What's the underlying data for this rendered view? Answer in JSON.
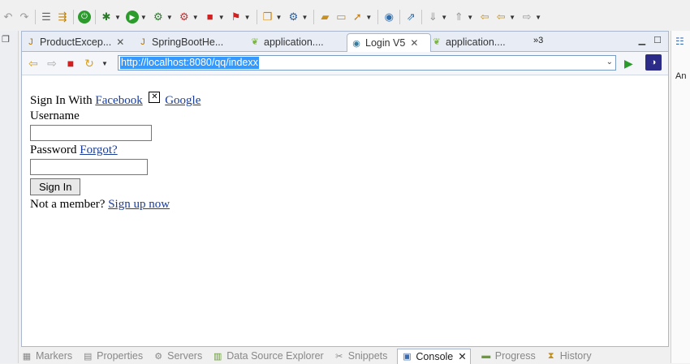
{
  "toolbar": {
    "icons": [
      "back-icon",
      "forward-icon",
      "sep",
      "menu-icon",
      "save-all-icon",
      "sep",
      "power-icon",
      "sep",
      "debug-icon",
      "run-icon",
      "run-config-icon",
      "stop-icon",
      "sep",
      "stop-server-icon",
      "new-project-icon",
      "sep",
      "open-type-icon",
      "folder-icon",
      "sep",
      "rocket-icon",
      "globe-icon",
      "sep",
      "external-tools-icon",
      "sep",
      "down-arrow-icon",
      "up-arrow-icon",
      "sep",
      "back-history-icon",
      "forward-history-icon"
    ]
  },
  "editor_tabs": [
    {
      "label": "ProductExcep...",
      "icon": "java-file-icon"
    },
    {
      "label": "SpringBootHe...",
      "icon": "java-file-icon"
    },
    {
      "label": "application....",
      "icon": "leaf-icon"
    },
    {
      "label": "Login V5",
      "icon": "globe-icon",
      "active": true
    },
    {
      "label": "application....",
      "icon": "leaf-icon"
    }
  ],
  "tab_overflow": "»3",
  "browser": {
    "url": "http://localhost:8080/qq/indexx"
  },
  "page": {
    "signin_with": "Sign In With",
    "facebook": "Facebook",
    "google": "Google",
    "username_label": "Username",
    "password_label": "Password",
    "forgot": "Forgot?",
    "signin_button": "Sign In",
    "not_member": "Not a member?",
    "signup": "Sign up now"
  },
  "right_panel": {
    "text": "An"
  },
  "bottom_tabs": [
    {
      "label": "Markers",
      "icon": "markers-icon"
    },
    {
      "label": "Properties",
      "icon": "properties-icon"
    },
    {
      "label": "Servers",
      "icon": "servers-icon"
    },
    {
      "label": "Data Source Explorer",
      "icon": "datasource-icon"
    },
    {
      "label": "Snippets",
      "icon": "snippets-icon"
    },
    {
      "label": "Console",
      "icon": "console-icon",
      "active": true
    },
    {
      "label": "Progress",
      "icon": "progress-icon"
    },
    {
      "label": "History",
      "icon": "history-icon"
    }
  ]
}
